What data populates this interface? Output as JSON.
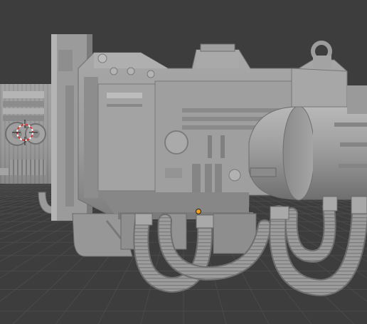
{
  "viewport": {
    "background": "#3d3d3d",
    "grid_color": "#4a4a4a",
    "model_base_color": "#9b9b9b",
    "model_shadow_color": "#707070",
    "model_highlight_color": "#c2c2c2",
    "cursor_color": "#d23a3a",
    "origin_color": "#f0a020"
  },
  "icons": {
    "cursor": "3d-cursor-icon",
    "origin": "origin-dot-icon"
  }
}
